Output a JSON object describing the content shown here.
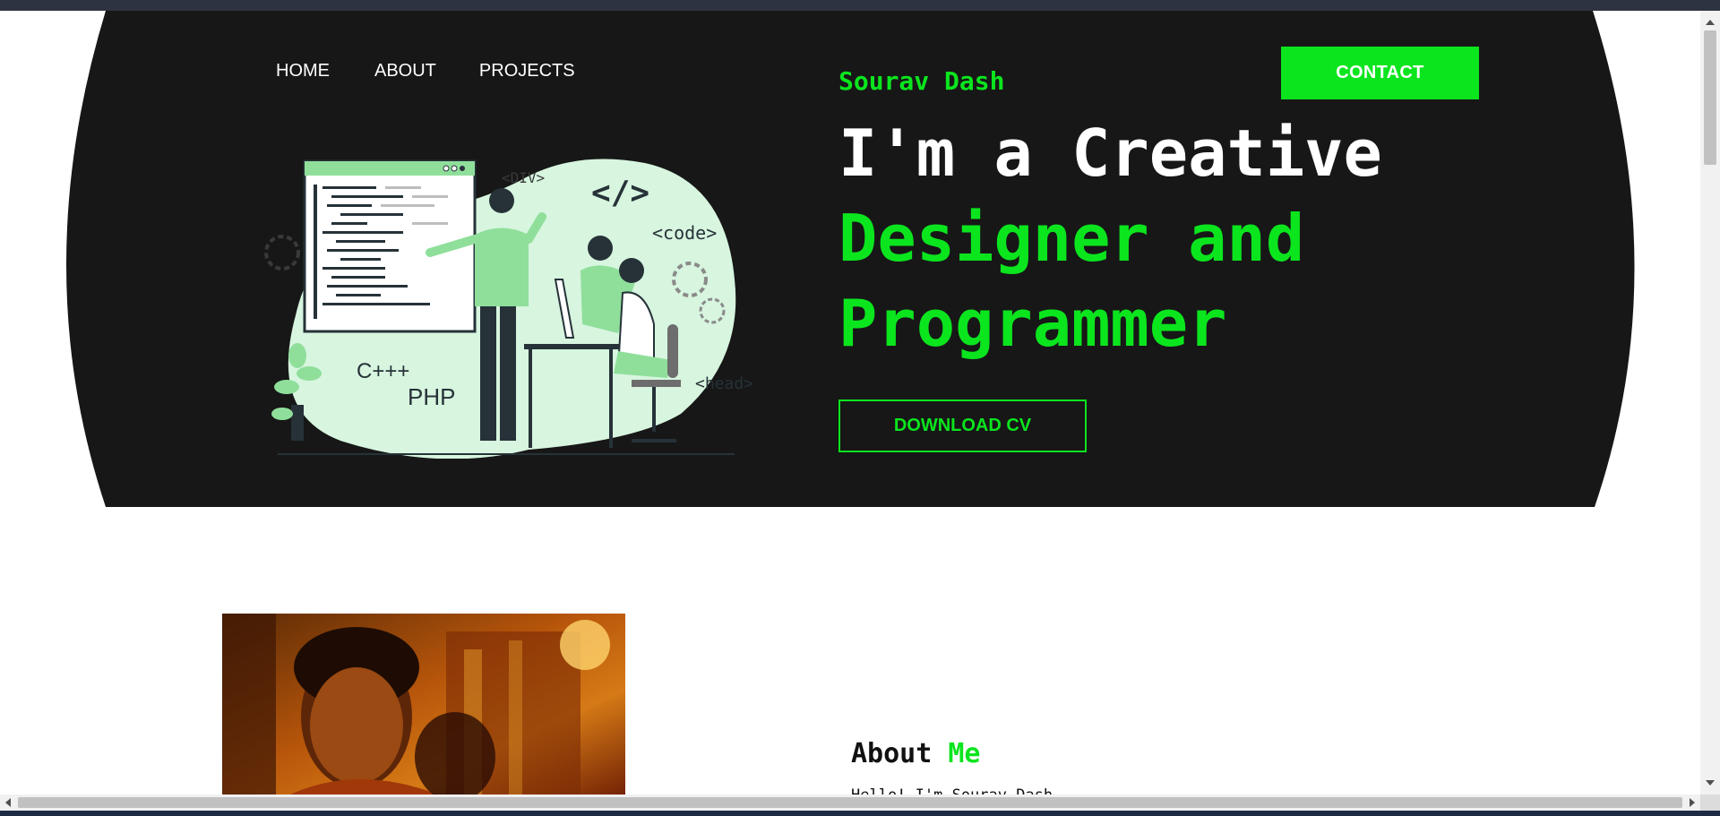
{
  "nav": {
    "home": "HOME",
    "about": "ABOUT",
    "projects": "PROJECTS"
  },
  "hero": {
    "name": "Sourav Dash",
    "title_line1": "I'm a Creative",
    "title_line2": "Designer and",
    "title_line3": "Programmer",
    "download_label": "DOWNLOAD CV",
    "contact_label": "CONTACT"
  },
  "illustration": {
    "tag_div": "<DIV>",
    "tag_code_symbol": "</>",
    "tag_code": "<code>",
    "tag_head": "<head>",
    "lang_cpp": "C+++",
    "lang_php": "PHP"
  },
  "about": {
    "heading_word1": "About",
    "heading_word2": "Me",
    "intro": "Hello! I'm Sourav Dash"
  },
  "colors": {
    "accent": "#0be51e",
    "hero_bg": "#171717",
    "illustration_light": "#d7f5df",
    "illustration_mid": "#8fdf9b",
    "illustration_dark": "#263238"
  }
}
